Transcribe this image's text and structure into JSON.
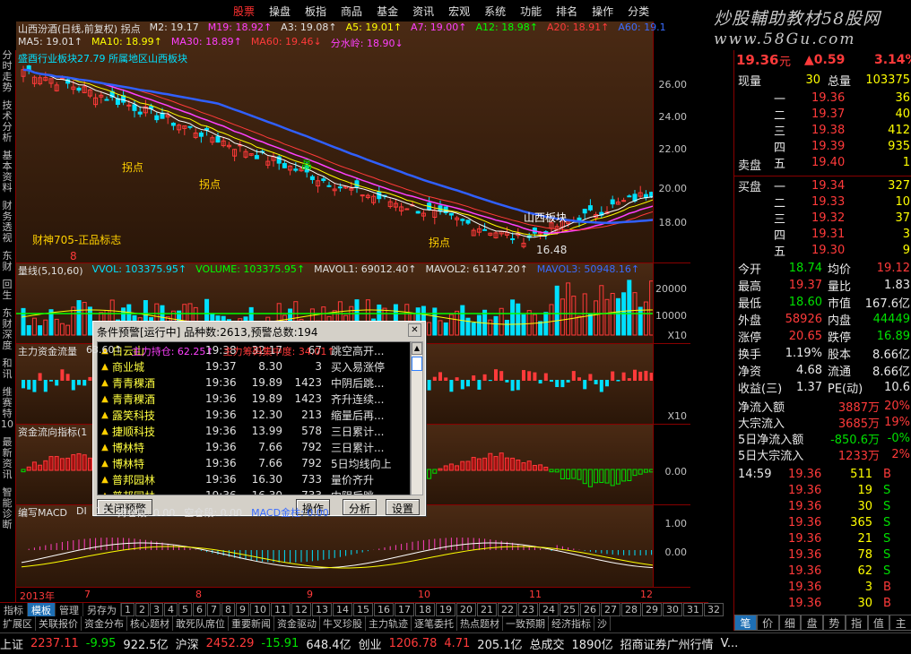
{
  "menu": {
    "items": [
      "股票",
      "操盘",
      "板指",
      "商品",
      "基金",
      "资讯",
      "宏观",
      "系统",
      "功能",
      "排名",
      "操作",
      "分类"
    ],
    "active": 0
  },
  "brand": {
    "line1": "炒股輔助教材58股网",
    "line2": "www.58Gu.com"
  },
  "left_tabs": [
    "分时走势",
    "技术分析",
    "基本资料",
    "财务透视",
    "东财",
    "回生",
    "东财深度",
    "和讯",
    "维赛特10",
    "最新资讯",
    "智能诊断"
  ],
  "kline": {
    "header1": [
      {
        "t": "山西汾酒(日线,前复权) 拐点",
        "c": "#e0e0e0"
      },
      {
        "t": "M2: 19.17",
        "c": "#e0e0e0"
      },
      {
        "t": "M19: 18.92↑",
        "c": "#ff40ff"
      },
      {
        "t": "A3: 19.08↑",
        "c": "#e0e0e0"
      },
      {
        "t": "A5: 19.01↑",
        "c": "#ffff00"
      },
      {
        "t": "A7: 19.00↑",
        "c": "#ff40ff"
      },
      {
        "t": "A12: 18.98↑",
        "c": "#00ff00"
      },
      {
        "t": "A20: 18.91↑",
        "c": "#ff3a3a"
      },
      {
        "t": "A60: 19.1",
        "c": "#3a6cff"
      }
    ],
    "header2": [
      {
        "t": "MA5: 19.01↑",
        "c": "#e0e0e0"
      },
      {
        "t": "MA10: 18.99↑",
        "c": "#ffff00"
      },
      {
        "t": "MA30: 18.89↑",
        "c": "#ff40ff"
      },
      {
        "t": "MA60: 19.46↓",
        "c": "#ff3a3a"
      },
      {
        "t": "分水岭: 18.90↓",
        "c": "#ff40ff"
      }
    ],
    "overlay": "盛酉行业板块27.79 所属地区山西板块",
    "labels": {
      "ghost": "财神705-正品标志",
      "guai1": "拐点",
      "guai2": "拐点",
      "guai3": "拐点",
      "sheng": "晶",
      "shanxi": "山西板块",
      "low": "16.48",
      "upper": "8"
    },
    "yticks": [
      "26.00",
      "24.00",
      "22.00",
      "20.00",
      "18.00"
    ]
  },
  "volume": {
    "header": [
      {
        "t": "量线(5,10,60)",
        "c": "#e0e0e0"
      },
      {
        "t": "VVOL: 103375.95↑",
        "c": "#00e0ff"
      },
      {
        "t": "VOLUME: 103375.95↑",
        "c": "#00ff00"
      },
      {
        "t": "MAVOL1: 69012.40↑",
        "c": "#e0e0e0"
      },
      {
        "t": "MAVOL2: 61147.20↑",
        "c": "#e0e0e0"
      },
      {
        "t": "MAVOL3: 50948.16↑",
        "c": "#3a6cff"
      }
    ],
    "yticks": [
      "20000",
      "10000"
    ],
    "unit": "X10"
  },
  "capital": {
    "header": [
      {
        "t": "主力资金流量",
        "c": "#e0e0e0"
      },
      {
        "t": "63.60↑",
        "c": "#e0e0e0"
      },
      {
        "t": "主力持仓: 62.25↑",
        "c": "#ff40ff"
      },
      {
        "t": "主力筹码集中度: 34.01↑",
        "c": "#ff3a3a"
      }
    ],
    "unit": "X10"
  },
  "flow": {
    "header": [
      {
        "t": "资金流向指标(1",
        "c": "#e0e0e0"
      }
    ],
    "yticks": [
      "0.00"
    ]
  },
  "macd": {
    "header": [
      {
        "t": "编写MACD",
        "c": "#e0e0e0"
      },
      {
        "t": "DI",
        "c": "#e0e0e0"
      },
      {
        "t": "10",
        "c": "#e0e0e0"
      },
      {
        "t": "持仓段: 0.00",
        "c": "#e0e0e0"
      },
      {
        "t": "空仓段: 0.00",
        "c": "#e0e0e0"
      },
      {
        "t": "MACD金柱: 0.00",
        "c": "#3a6cff"
      }
    ],
    "yticks": [
      "1.00",
      "0.00"
    ]
  },
  "dateaxis": {
    "year": "2013年",
    "months": [
      "7",
      "8",
      "9",
      "10",
      "11",
      "12"
    ],
    "period": "日线"
  },
  "toolbar1": {
    "items": [
      "指标",
      "模板",
      "管理",
      "另存为"
    ],
    "active": 1,
    "nums": [
      "1",
      "2",
      "3",
      "4",
      "5",
      "6",
      "7",
      "8",
      "9",
      "10",
      "11",
      "12",
      "13",
      "14",
      "15",
      "16",
      "17",
      "18",
      "19",
      "20",
      "21",
      "22",
      "23",
      "24",
      "25",
      "26",
      "27",
      "28",
      "29",
      "30",
      "31",
      "32"
    ]
  },
  "toolbar2": [
    "扩展区",
    "关联报价",
    "资金分布",
    "核心题材",
    "敢死队席位",
    "重要新闻",
    "资金驱动",
    "牛叉珍股",
    "主力轨迹",
    "逐笔委托",
    "热点题材",
    "一致预期",
    "经济指标",
    "",
    "沙"
  ],
  "quote": {
    "price": "19.36",
    "unit": "元",
    "change": "▲0.59",
    "pct": "3.14%",
    "xianliang_label": "现量",
    "xianliang": "30",
    "zongliang_label": "总量",
    "zongliang": "103375",
    "sell_label": "卖盘",
    "buy_label": "买盘",
    "asks": [
      {
        "lv": "五",
        "p": "19.40",
        "v": "1",
        "c": "red"
      },
      {
        "lv": "四",
        "p": "19.39",
        "v": "935",
        "c": "red"
      },
      {
        "lv": "三",
        "p": "19.38",
        "v": "412",
        "c": "red"
      },
      {
        "lv": "二",
        "p": "19.37",
        "v": "40",
        "c": "red"
      },
      {
        "lv": "一",
        "p": "19.36",
        "v": "36",
        "c": "red"
      }
    ],
    "bids": [
      {
        "lv": "一",
        "p": "19.34",
        "v": "327",
        "c": "red"
      },
      {
        "lv": "二",
        "p": "19.33",
        "v": "10",
        "c": "red"
      },
      {
        "lv": "三",
        "p": "19.32",
        "v": "37",
        "c": "red"
      },
      {
        "lv": "四",
        "p": "19.31",
        "v": "3",
        "c": "red"
      },
      {
        "lv": "五",
        "p": "19.30",
        "v": "9",
        "c": "red"
      }
    ],
    "stats": [
      [
        {
          "t": "今开",
          "c": "white"
        },
        {
          "t": "18.74",
          "c": "green"
        },
        {
          "t": "均价",
          "c": "white"
        },
        {
          "t": "19.12",
          "c": "red"
        }
      ],
      [
        {
          "t": "最高",
          "c": "white"
        },
        {
          "t": "19.37",
          "c": "red"
        },
        {
          "t": "量比",
          "c": "white"
        },
        {
          "t": "1.83",
          "c": "white"
        }
      ],
      [
        {
          "t": "最低",
          "c": "white"
        },
        {
          "t": "18.60",
          "c": "green"
        },
        {
          "t": "市值",
          "c": "white"
        },
        {
          "t": "167.6亿",
          "c": "white"
        }
      ],
      [
        {
          "t": "外盘",
          "c": "white"
        },
        {
          "t": "58926",
          "c": "red"
        },
        {
          "t": "内盘",
          "c": "white"
        },
        {
          "t": "44449",
          "c": "green"
        }
      ],
      [
        {
          "t": "涨停",
          "c": "white"
        },
        {
          "t": "20.65",
          "c": "red"
        },
        {
          "t": "跌停",
          "c": "white"
        },
        {
          "t": "16.89",
          "c": "green"
        }
      ],
      [
        {
          "t": "换手",
          "c": "white"
        },
        {
          "t": "1.19%",
          "c": "white"
        },
        {
          "t": "股本",
          "c": "white"
        },
        {
          "t": "8.66亿",
          "c": "white"
        }
      ],
      [
        {
          "t": "净资",
          "c": "white"
        },
        {
          "t": "4.68",
          "c": "white"
        },
        {
          "t": "流通",
          "c": "white"
        },
        {
          "t": "8.66亿",
          "c": "white"
        }
      ],
      [
        {
          "t": "收益(三)",
          "c": "white"
        },
        {
          "t": "1.37",
          "c": "white"
        },
        {
          "t": "PE(动)",
          "c": "white"
        },
        {
          "t": "10.6",
          "c": "white"
        }
      ]
    ],
    "flows": [
      {
        "l": "净流入额",
        "v": "3887万",
        "p": "20%",
        "c": "red"
      },
      {
        "l": "大宗流入",
        "v": "3685万",
        "p": "19%",
        "c": "red"
      },
      {
        "l": "5日净流入额",
        "v": "-850.6万",
        "p": "-0%",
        "c": "green"
      },
      {
        "l": "5日大宗流入",
        "v": "1233万",
        "p": "2%",
        "c": "red"
      }
    ],
    "ticks": [
      {
        "t": "14:59",
        "p": "19.36",
        "v": "511",
        "s": "B",
        "sc": "red"
      },
      {
        "t": "",
        "p": "19.36",
        "v": "19",
        "s": "S",
        "sc": "green"
      },
      {
        "t": "",
        "p": "19.36",
        "v": "30",
        "s": "S",
        "sc": "green"
      },
      {
        "t": "",
        "p": "19.36",
        "v": "365",
        "s": "S",
        "sc": "green"
      },
      {
        "t": "",
        "p": "19.36",
        "v": "21",
        "s": "S",
        "sc": "green"
      },
      {
        "t": "",
        "p": "19.36",
        "v": "78",
        "s": "S",
        "sc": "green"
      },
      {
        "t": "",
        "p": "19.36",
        "v": "62",
        "s": "S",
        "sc": "green"
      },
      {
        "t": "",
        "p": "19.36",
        "v": "3",
        "s": "B",
        "sc": "red"
      },
      {
        "t": "",
        "p": "19.36",
        "v": "30",
        "s": "B",
        "sc": "red"
      }
    ],
    "bottom_tabs": [
      "笔",
      "价",
      "细",
      "盘",
      "势",
      "指",
      "值",
      "主"
    ]
  },
  "status": [
    {
      "t": "上证",
      "c": "white"
    },
    {
      "t": "2237.11",
      "c": "red"
    },
    {
      "t": "-9.95",
      "c": "green"
    },
    {
      "t": "922.5亿",
      "c": "white"
    },
    {
      "t": "沪深",
      "c": "white"
    },
    {
      "t": "2452.29",
      "c": "red"
    },
    {
      "t": "-15.91",
      "c": "green"
    },
    {
      "t": "648.4亿",
      "c": "white"
    },
    {
      "t": "创业",
      "c": "white"
    },
    {
      "t": "1206.78",
      "c": "red"
    },
    {
      "t": "4.71",
      "c": "red"
    },
    {
      "t": "205.1亿",
      "c": "white"
    },
    {
      "t": "总成交",
      "c": "white"
    },
    {
      "t": "1890亿",
      "c": "white"
    },
    {
      "t": "招商证券广州行情",
      "c": "white"
    },
    {
      "t": "V...",
      "c": "white"
    }
  ],
  "dialog": {
    "title": "条件预警[运行中] 品种数:2613,预警总数:194",
    "rows": [
      {
        "name": "白云山",
        "time": "19:38",
        "price": "32.17",
        "vol": "67",
        "event": "跳空高开..."
      },
      {
        "name": "商业城",
        "time": "19:37",
        "price": "8.30",
        "vol": "3",
        "event": "买入易涨停"
      },
      {
        "name": "青青稞酒",
        "time": "19:36",
        "price": "19.89",
        "vol": "1423",
        "event": "中阴后跳..."
      },
      {
        "name": "青青稞酒",
        "time": "19:36",
        "price": "19.89",
        "vol": "1423",
        "event": "齐升连续..."
      },
      {
        "name": "露笑科技",
        "time": "19:36",
        "price": "12.30",
        "vol": "213",
        "event": "缩量后再..."
      },
      {
        "name": "捷顺科技",
        "time": "19:36",
        "price": "13.99",
        "vol": "578",
        "event": "三日累计..."
      },
      {
        "name": "博林特",
        "time": "19:36",
        "price": "7.66",
        "vol": "792",
        "event": "三日累计..."
      },
      {
        "name": "博林特",
        "time": "19:36",
        "price": "7.66",
        "vol": "792",
        "event": "5日均线向上"
      },
      {
        "name": "普邦园林",
        "time": "19:36",
        "price": "16.30",
        "vol": "733",
        "event": "量价齐升"
      },
      {
        "name": "普邦园林",
        "time": "19:36",
        "price": "16.30",
        "vol": "733",
        "event": "中阴后跳..."
      }
    ],
    "buttons": {
      "close": "关闭预警",
      "op": "操作",
      "analyze": "分析",
      "settings": "设置"
    }
  },
  "colors": {
    "up": "#ff3a3a",
    "down": "#00e0ff",
    "bg": "#3a200e"
  }
}
